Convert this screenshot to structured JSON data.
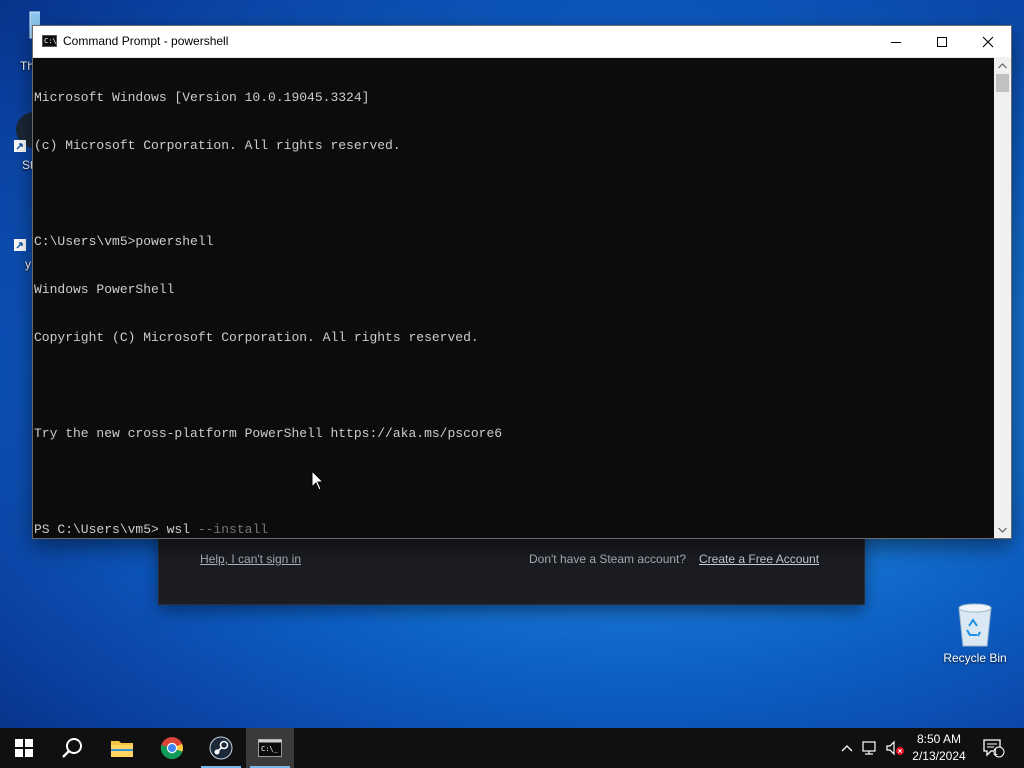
{
  "desktop": {
    "partial_labels": [
      "Th",
      "St",
      "y"
    ],
    "recycle_bin_label": "Recycle Bin"
  },
  "steam_window": {
    "help_link": "Help, I can't sign in",
    "no_account_text": "Don't have a Steam account?",
    "create_account_link": "Create a Free Account"
  },
  "console": {
    "title": "Command Prompt - powershell",
    "icon_text": "C:\\_",
    "lines": [
      "Microsoft Windows [Version 10.0.19045.3324]",
      "(c) Microsoft Corporation. All rights reserved.",
      "",
      "C:\\Users\\vm5>powershell",
      "Windows PowerShell",
      "Copyright (C) Microsoft Corporation. All rights reserved.",
      "",
      "Try the new cross-platform PowerShell https://aka.ms/pscore6",
      ""
    ],
    "prompt": "PS C:\\Users\\vm5> ",
    "command": "wsl",
    "command_suggestion": " --install"
  },
  "taskbar": {
    "apps": [
      "start-icon",
      "search-icon",
      "file-explorer-icon",
      "chrome-icon",
      "steam-icon",
      "command-prompt-icon"
    ],
    "time": "8:50 AM",
    "date": "2/13/2024",
    "notification_count": "1"
  },
  "colors": {
    "console_bg": "#0c0c0c",
    "console_text": "#cccccc",
    "taskbar_bg": "#101010",
    "accent": "#76b9ed"
  }
}
